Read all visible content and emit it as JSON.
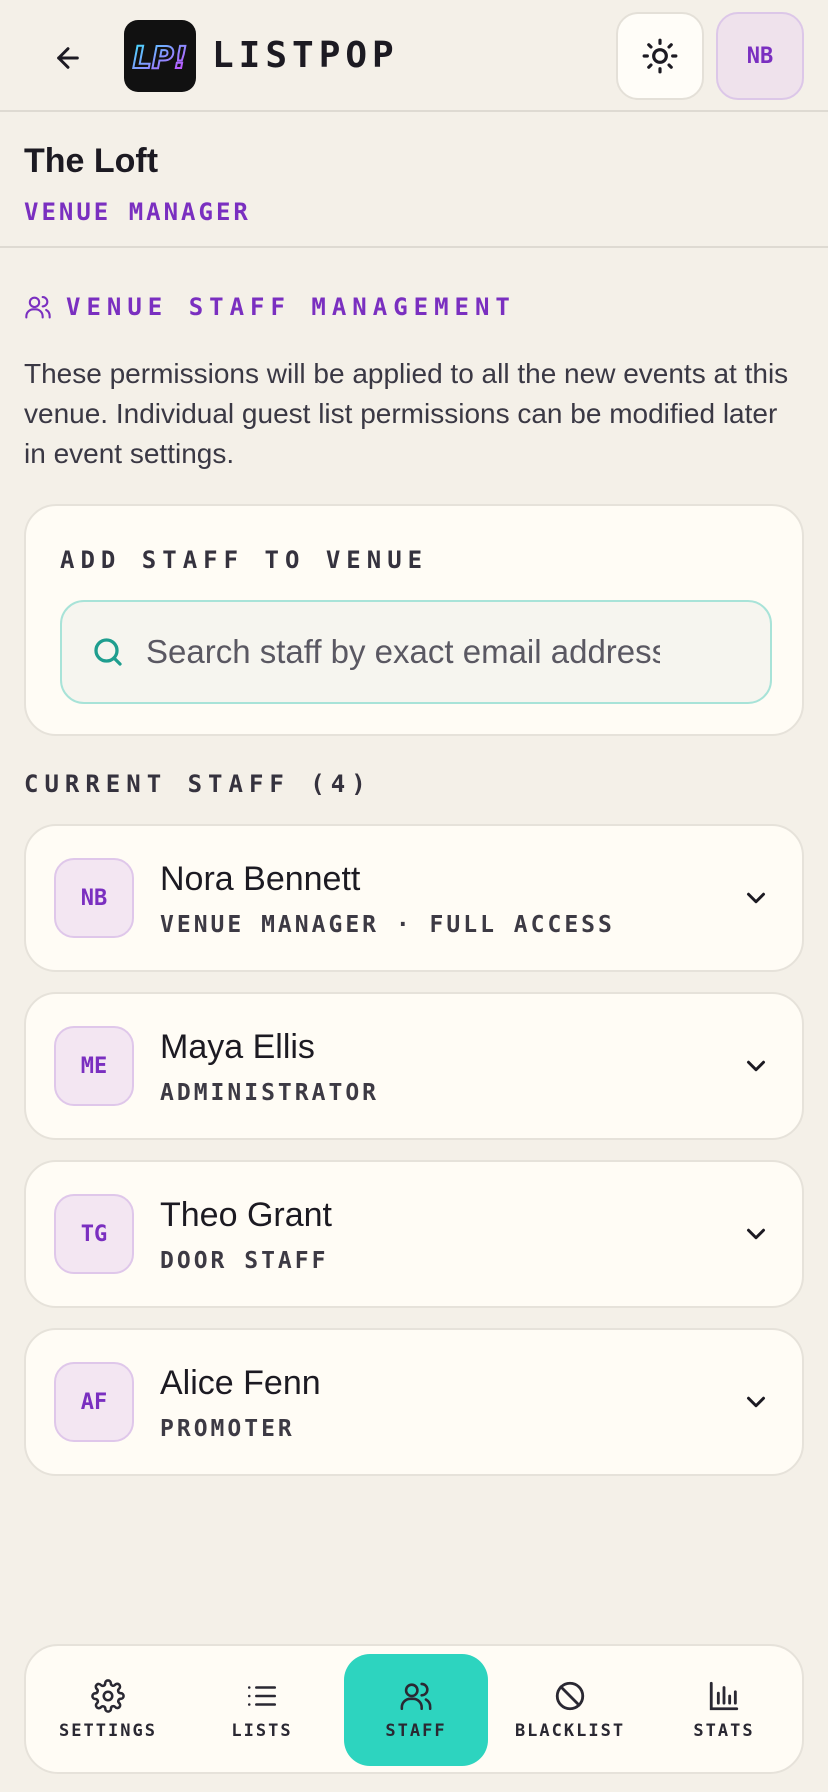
{
  "header": {
    "brand": "LISTPOP",
    "logo_text": "LP!",
    "user_initials": "NB"
  },
  "venue": {
    "name": "The Loft",
    "role": "VENUE MANAGER"
  },
  "section": {
    "title": "VENUE STAFF MANAGEMENT",
    "description": "These permissions will be applied to all the new events at this venue. Individual guest list permissions can be modified later in event settings."
  },
  "add_staff": {
    "label": "ADD STAFF TO VENUE",
    "search_placeholder": "Search staff by exact email address"
  },
  "current_staff": {
    "label": "CURRENT STAFF (4)",
    "members": [
      {
        "initials": "NB",
        "name": "Nora Bennett",
        "role": "VENUE MANAGER · FULL ACCESS"
      },
      {
        "initials": "ME",
        "name": "Maya Ellis",
        "role": "ADMINISTRATOR"
      },
      {
        "initials": "TG",
        "name": "Theo Grant",
        "role": "DOOR STAFF"
      },
      {
        "initials": "AF",
        "name": "Alice Fenn",
        "role": "PROMOTER"
      }
    ]
  },
  "nav": {
    "items": [
      {
        "label": "SETTINGS",
        "icon": "gear-icon"
      },
      {
        "label": "LISTS",
        "icon": "list-icon"
      },
      {
        "label": "STAFF",
        "icon": "users-icon",
        "active": true
      },
      {
        "label": "BLACKLIST",
        "icon": "ban-icon"
      },
      {
        "label": "STATS",
        "icon": "bar-chart-icon"
      }
    ]
  },
  "colors": {
    "accent": "#7a2fc0",
    "active_tab": "#2dd4bf",
    "background": "#f4f0e8"
  }
}
